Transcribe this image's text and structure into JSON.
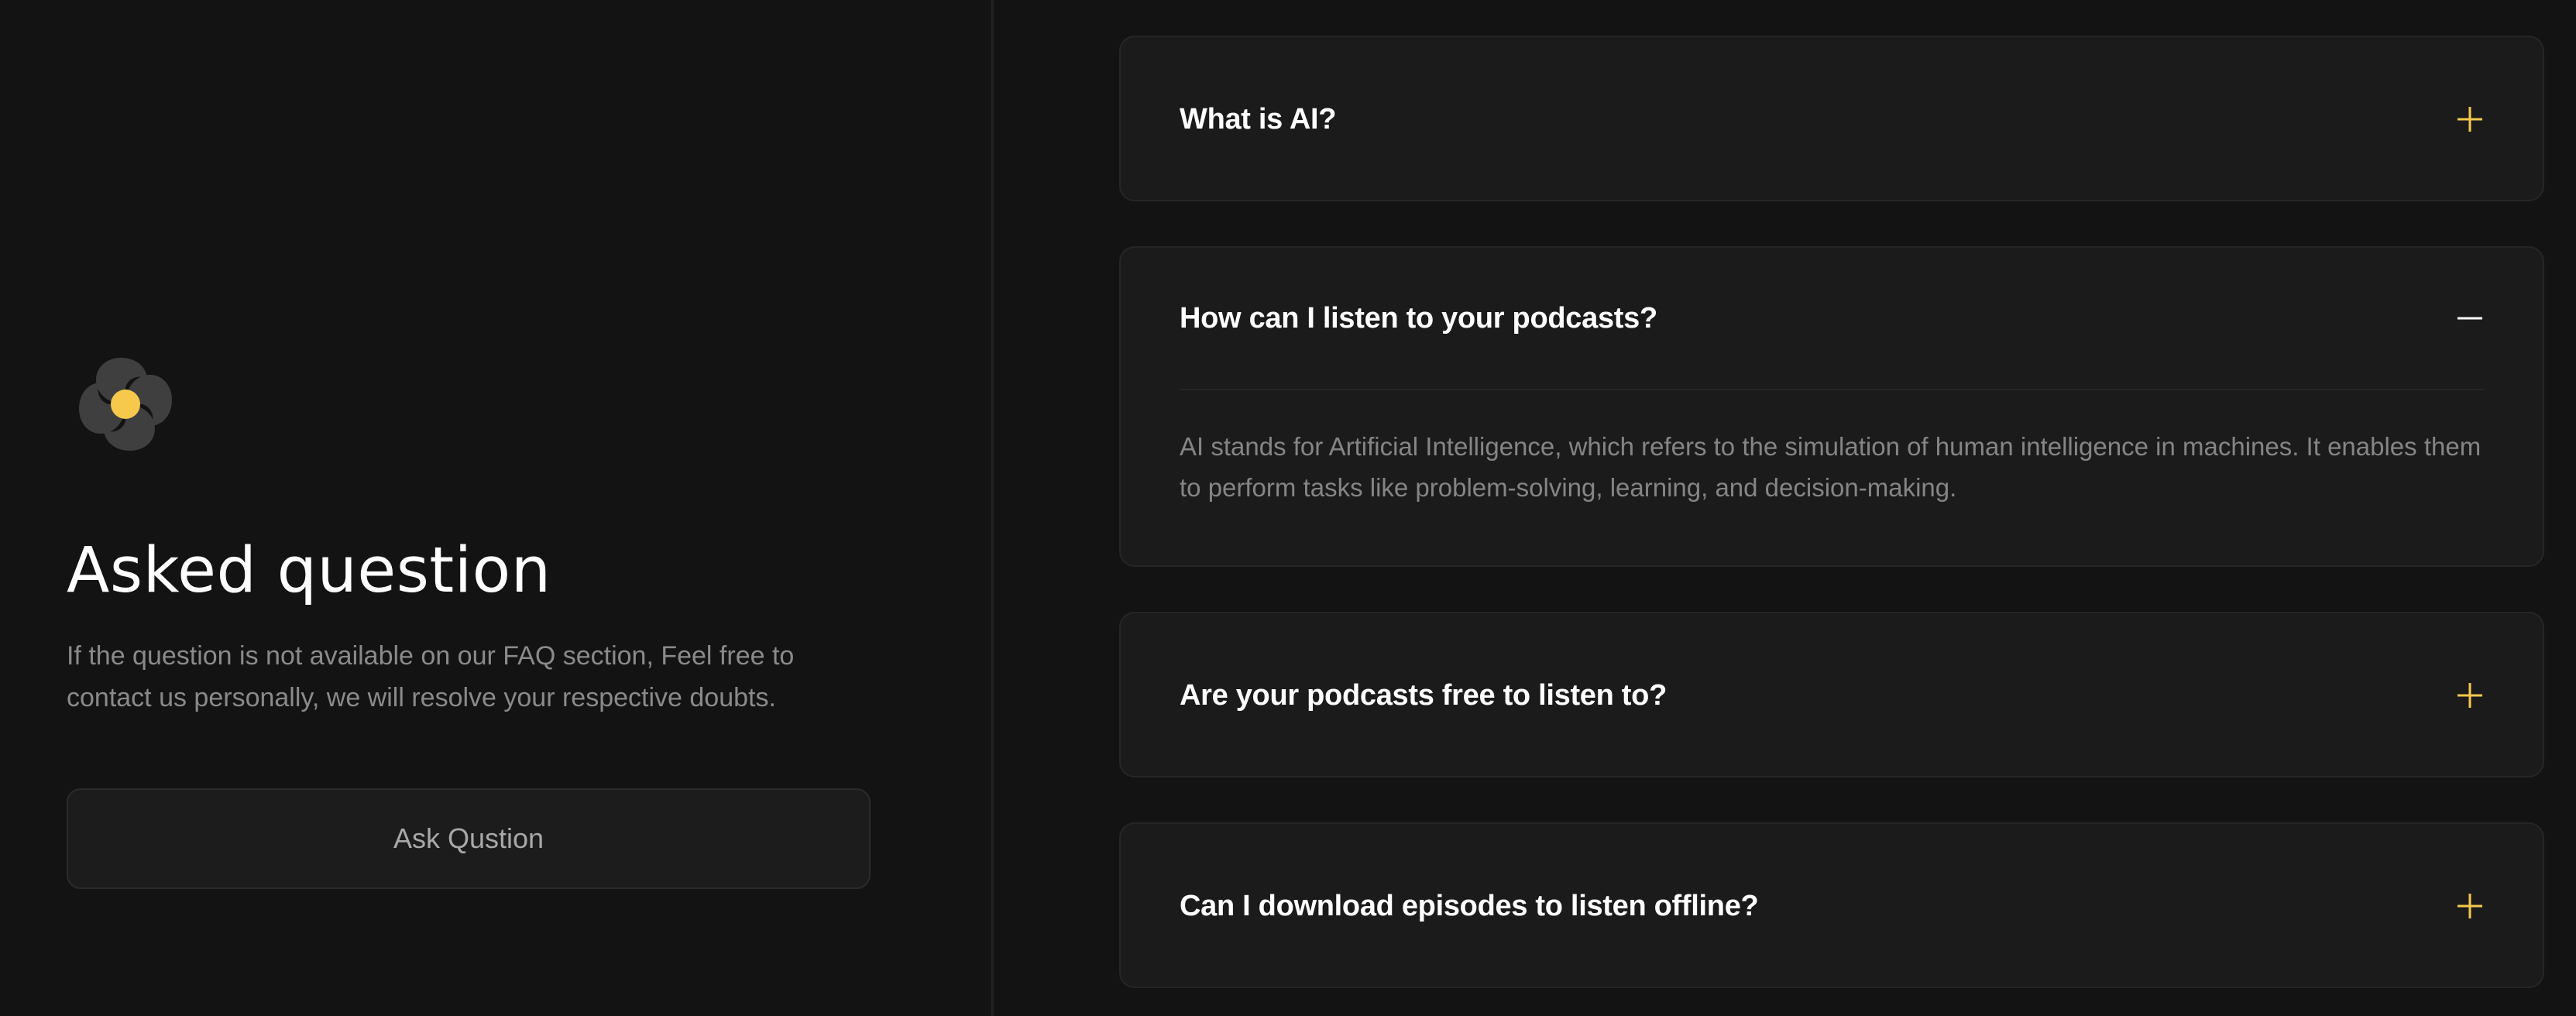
{
  "left": {
    "title": "Asked question",
    "subtitle": "If the question is not available on our FAQ section, Feel free to contact us personally, we will resolve your respective doubts.",
    "ask_button_label": "Ask Qustion"
  },
  "faq": {
    "items": [
      {
        "question": "What is AI?",
        "expanded": false,
        "icon": "plus-icon"
      },
      {
        "question": "How can I listen to your podcasts?",
        "expanded": true,
        "icon": "minus-icon",
        "answer": "AI stands for Artificial Intelligence, which refers to the simulation of human intelligence in machines. It enables them to perform tasks like problem-solving, learning, and decision-making."
      },
      {
        "question": "Are your podcasts free to listen to?",
        "expanded": false,
        "icon": "plus-icon"
      },
      {
        "question": "Can I download episodes to listen offline?",
        "expanded": false,
        "icon": "plus-icon"
      }
    ]
  },
  "colors": {
    "background": "#131313",
    "card": "#1b1b1b",
    "accent": "#f6c94c",
    "logo_gray": "#3f3f3f",
    "text_muted": "#8a8a8a"
  }
}
